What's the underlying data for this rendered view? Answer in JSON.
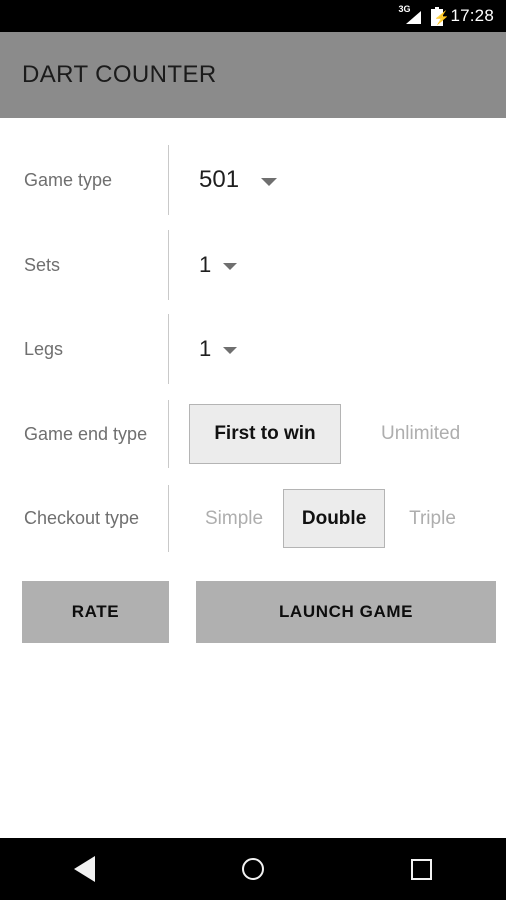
{
  "status_bar": {
    "network_label": "3G",
    "network_icon": "signal-3g-icon",
    "battery_icon": "battery-charging-icon",
    "time": "17:28"
  },
  "toolbar": {
    "title": "DART COUNTER",
    "background_color": "#8b8b8b"
  },
  "form": {
    "rows": [
      {
        "label": "Game type",
        "type": "spinner",
        "value": "501",
        "caret_icon": "chevron-down-icon"
      },
      {
        "label": "Sets",
        "type": "spinner",
        "value": "1",
        "caret_icon": "chevron-down-icon"
      },
      {
        "label": "Legs",
        "type": "spinner",
        "value": "1",
        "caret_icon": "chevron-down-icon"
      },
      {
        "label": "Game end type",
        "type": "options",
        "options": [
          "First to win",
          "Unlimited"
        ],
        "selected": "First to win"
      },
      {
        "label": "Checkout type",
        "type": "options",
        "options": [
          "Simple",
          "Double",
          "Triple"
        ],
        "selected": "Double"
      }
    ]
  },
  "buttons": {
    "rate": "RATE",
    "launch": "LAUNCH GAME",
    "background_color": "#b0b0b0"
  },
  "nav_bar": {
    "back_icon": "back-triangle-icon",
    "home_icon": "home-circle-icon",
    "recents_icon": "recents-square-icon"
  }
}
